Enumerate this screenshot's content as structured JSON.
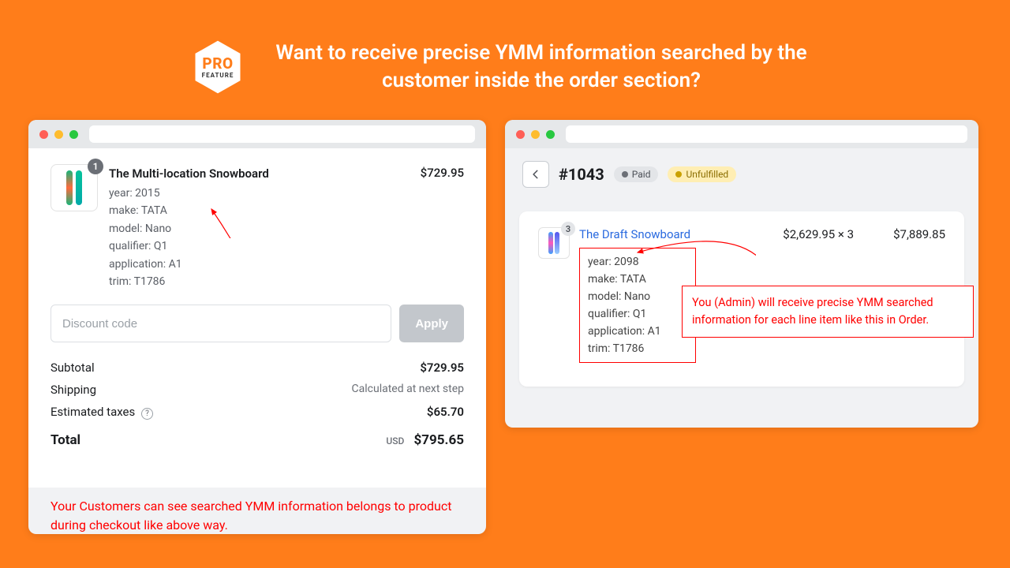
{
  "hero": {
    "badge_top": "PRO",
    "badge_bottom": "FEATURE",
    "headline": "Want to receive precise YMM information searched by the customer inside the order section?"
  },
  "checkout": {
    "qty_badge": "1",
    "product_title": "The Multi-location Snowboard",
    "attrs": {
      "year": "year: 2015",
      "make": "make: TATA",
      "model": "model: Nano",
      "qualifier": "qualifier: Q1",
      "application": "application: A1",
      "trim": "trim: T1786"
    },
    "price": "$729.95",
    "discount_placeholder": "Discount code",
    "apply_label": "Apply",
    "rows": {
      "subtotal_label": "Subtotal",
      "subtotal_value": "$729.95",
      "shipping_label": "Shipping",
      "shipping_value": "Calculated at next step",
      "tax_label": "Estimated taxes",
      "tax_value": "$65.70",
      "total_label": "Total",
      "total_currency": "USD",
      "total_value": "$795.65"
    },
    "note": "Your Customers can see searched YMM information belongs to product during checkout like above way."
  },
  "order": {
    "id": "#1043",
    "paid_label": "Paid",
    "unfulfilled_label": "Unfulfilled",
    "line": {
      "qty_badge": "3",
      "name": "The Draft Snowboard",
      "unit": "$2,629.95 × 3",
      "line_total": "$7,889.85"
    },
    "ymm": {
      "year": "year: 2098",
      "make": "make: TATA",
      "model": "model: Nano",
      "qualifier": "qualifier: Q1",
      "application": "application: A1",
      "trim": "trim: T1786"
    },
    "admin_note": "You (Admin) will receive precise YMM searched information for each line item like this in Order."
  }
}
